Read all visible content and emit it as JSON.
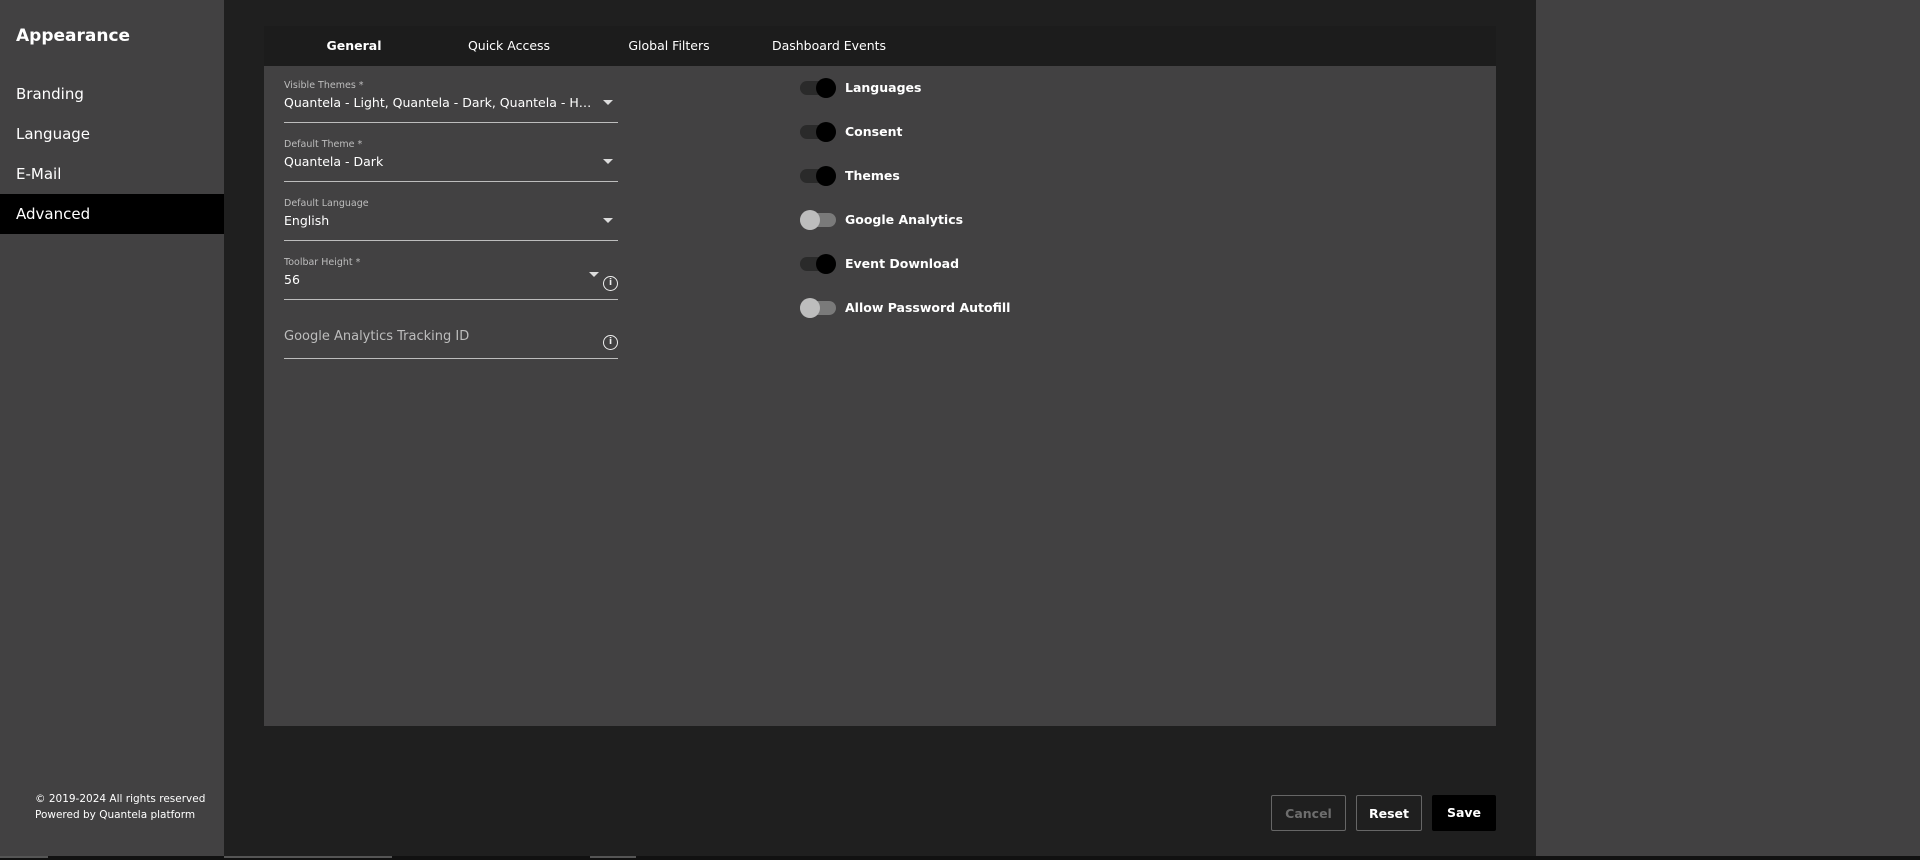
{
  "sidebar": {
    "title": "Appearance",
    "items": [
      {
        "label": "Branding"
      },
      {
        "label": "Language"
      },
      {
        "label": "E-Mail"
      },
      {
        "label": "Advanced"
      }
    ],
    "active": "Advanced",
    "footer": {
      "copyright": "© 2019-2024 All rights reserved",
      "powered_by": "Powered by Quantela platform"
    }
  },
  "tabs": [
    {
      "label": "General",
      "active": true
    },
    {
      "label": "Quick Access",
      "active": false
    },
    {
      "label": "Global Filters",
      "active": false
    },
    {
      "label": "Dashboard Events",
      "active": false
    }
  ],
  "form": {
    "visible_themes": {
      "label": "Visible Themes *",
      "value": "Quantela - Light, Quantela - Dark, Quantela - Heav..."
    },
    "default_theme": {
      "label": "Default Theme *",
      "value": "Quantela - Dark"
    },
    "default_language": {
      "label": "Default Language",
      "value": "English"
    },
    "toolbar_height": {
      "label": "Toolbar Height *",
      "value": "56"
    },
    "ga_tracking": {
      "placeholder": "Google Analytics Tracking ID"
    }
  },
  "toggles": [
    {
      "label": "Languages",
      "on": true
    },
    {
      "label": "Consent",
      "on": true
    },
    {
      "label": "Themes",
      "on": true
    },
    {
      "label": "Google Analytics",
      "on": false
    },
    {
      "label": "Event Download",
      "on": true
    },
    {
      "label": "Allow Password Autofill",
      "on": false
    }
  ],
  "actions": {
    "cancel": "Cancel",
    "reset": "Reset",
    "save": "Save"
  },
  "icons": {
    "info": "info-icon",
    "dropdown": "chevron-down-icon"
  },
  "colors": {
    "sidebar_bg": "#424142",
    "active_nav": "#000000",
    "panel_bg": "#424142",
    "page_bg": "#1f1f1f"
  }
}
